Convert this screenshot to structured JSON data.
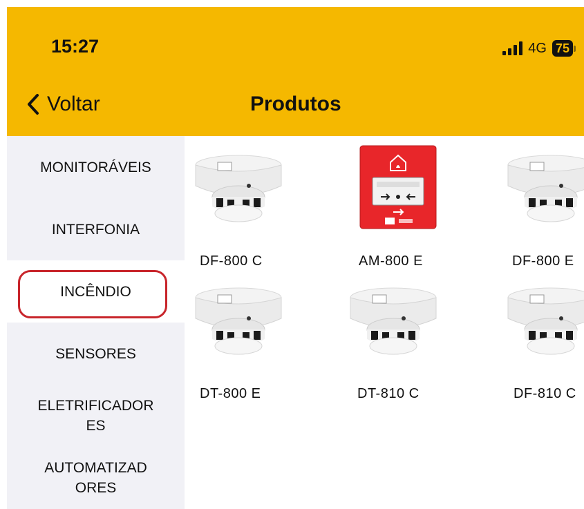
{
  "status_bar": {
    "time": "15:27",
    "network": "4G",
    "battery": "75",
    "signal_icon": "signal-bars-icon"
  },
  "nav": {
    "back_label": "Voltar",
    "back_icon": "chevron-left-icon",
    "title": "Produtos"
  },
  "categories": [
    {
      "label": "MONITORÁVEIS"
    },
    {
      "label": "INTERFONIA"
    },
    {
      "label": "INCÊNDIO"
    },
    {
      "label": "SENSORES"
    },
    {
      "label": "ELETRIFICADOR\nES"
    },
    {
      "label": "AUTOMATIZAD\nORES"
    }
  ],
  "selected_category": "INCÊNDIO",
  "products": [
    {
      "name": "DF-800 C",
      "icon": "smoke-detector-icon"
    },
    {
      "name": "AM-800 E",
      "icon": "manual-alarm-button-icon"
    },
    {
      "name": "DF-800 E",
      "icon": "smoke-detector-icon"
    },
    {
      "name": "DT-800 E",
      "icon": "smoke-detector-icon"
    },
    {
      "name": "DT-810 C",
      "icon": "smoke-detector-icon"
    },
    {
      "name": "DF-810 C",
      "icon": "smoke-detector-icon"
    }
  ],
  "colors": {
    "header": "#F5B800",
    "sidebar": "#F1F1F6",
    "highlight": "#C8252B",
    "alarm_red": "#E8262A"
  }
}
